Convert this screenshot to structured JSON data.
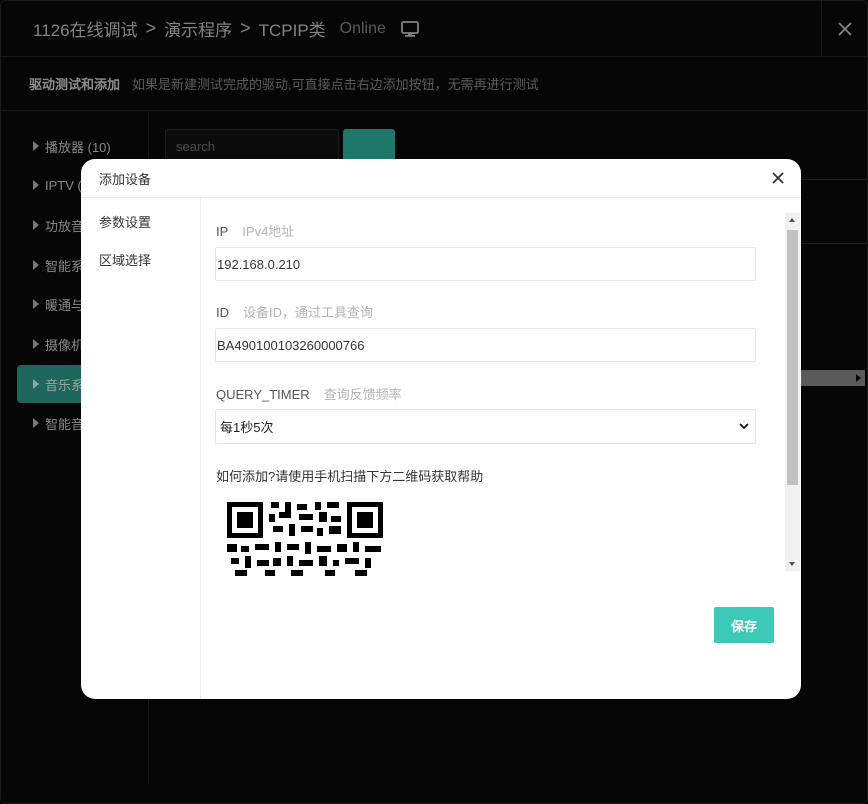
{
  "app": {
    "breadcrumb": [
      "1126在线调试",
      "演示程序",
      "TCPIP类"
    ],
    "status": "Online",
    "monitor_icon": "monitor-icon",
    "close_icon": "close-icon"
  },
  "subheader": {
    "title": "驱动测试和添加",
    "description": "如果是新建测试完成的驱动,可直接点击右边添加按钮，无需再进行测试"
  },
  "sidebar": {
    "items": [
      {
        "label": "播放器 (10)",
        "active": false
      },
      {
        "label": "IPTV (",
        "active": false
      },
      {
        "label": "功放音",
        "active": false
      },
      {
        "label": "智能系",
        "active": false
      },
      {
        "label": "暖通与",
        "active": false
      },
      {
        "label": "摄像机",
        "active": false
      },
      {
        "label": "音乐系",
        "active": true
      },
      {
        "label": "智能音",
        "active": false
      }
    ]
  },
  "background": {
    "search_placeholder": "search",
    "search_icon": "search-icon"
  },
  "modal": {
    "title": "添加设备",
    "nav": [
      "参数设置",
      "区域选择"
    ],
    "fields": {
      "ip": {
        "label": "IP",
        "hint": "IPv4地址",
        "value": "192.168.0.210"
      },
      "id": {
        "label": "ID",
        "hint": "设备ID，通过工具查询",
        "value": "BA490100103260000766"
      },
      "query_timer": {
        "label": "QUERY_TIMER",
        "hint": "查询反馈频率",
        "value": "每1秒5次"
      }
    },
    "help_text": "如何添加?请使用手机扫描下方二维码获取帮助",
    "save_label": "保存"
  },
  "colors": {
    "accent": "#3cc9b7",
    "sidebar_active": "#2e9b8c",
    "background": "#0a0a0a"
  }
}
